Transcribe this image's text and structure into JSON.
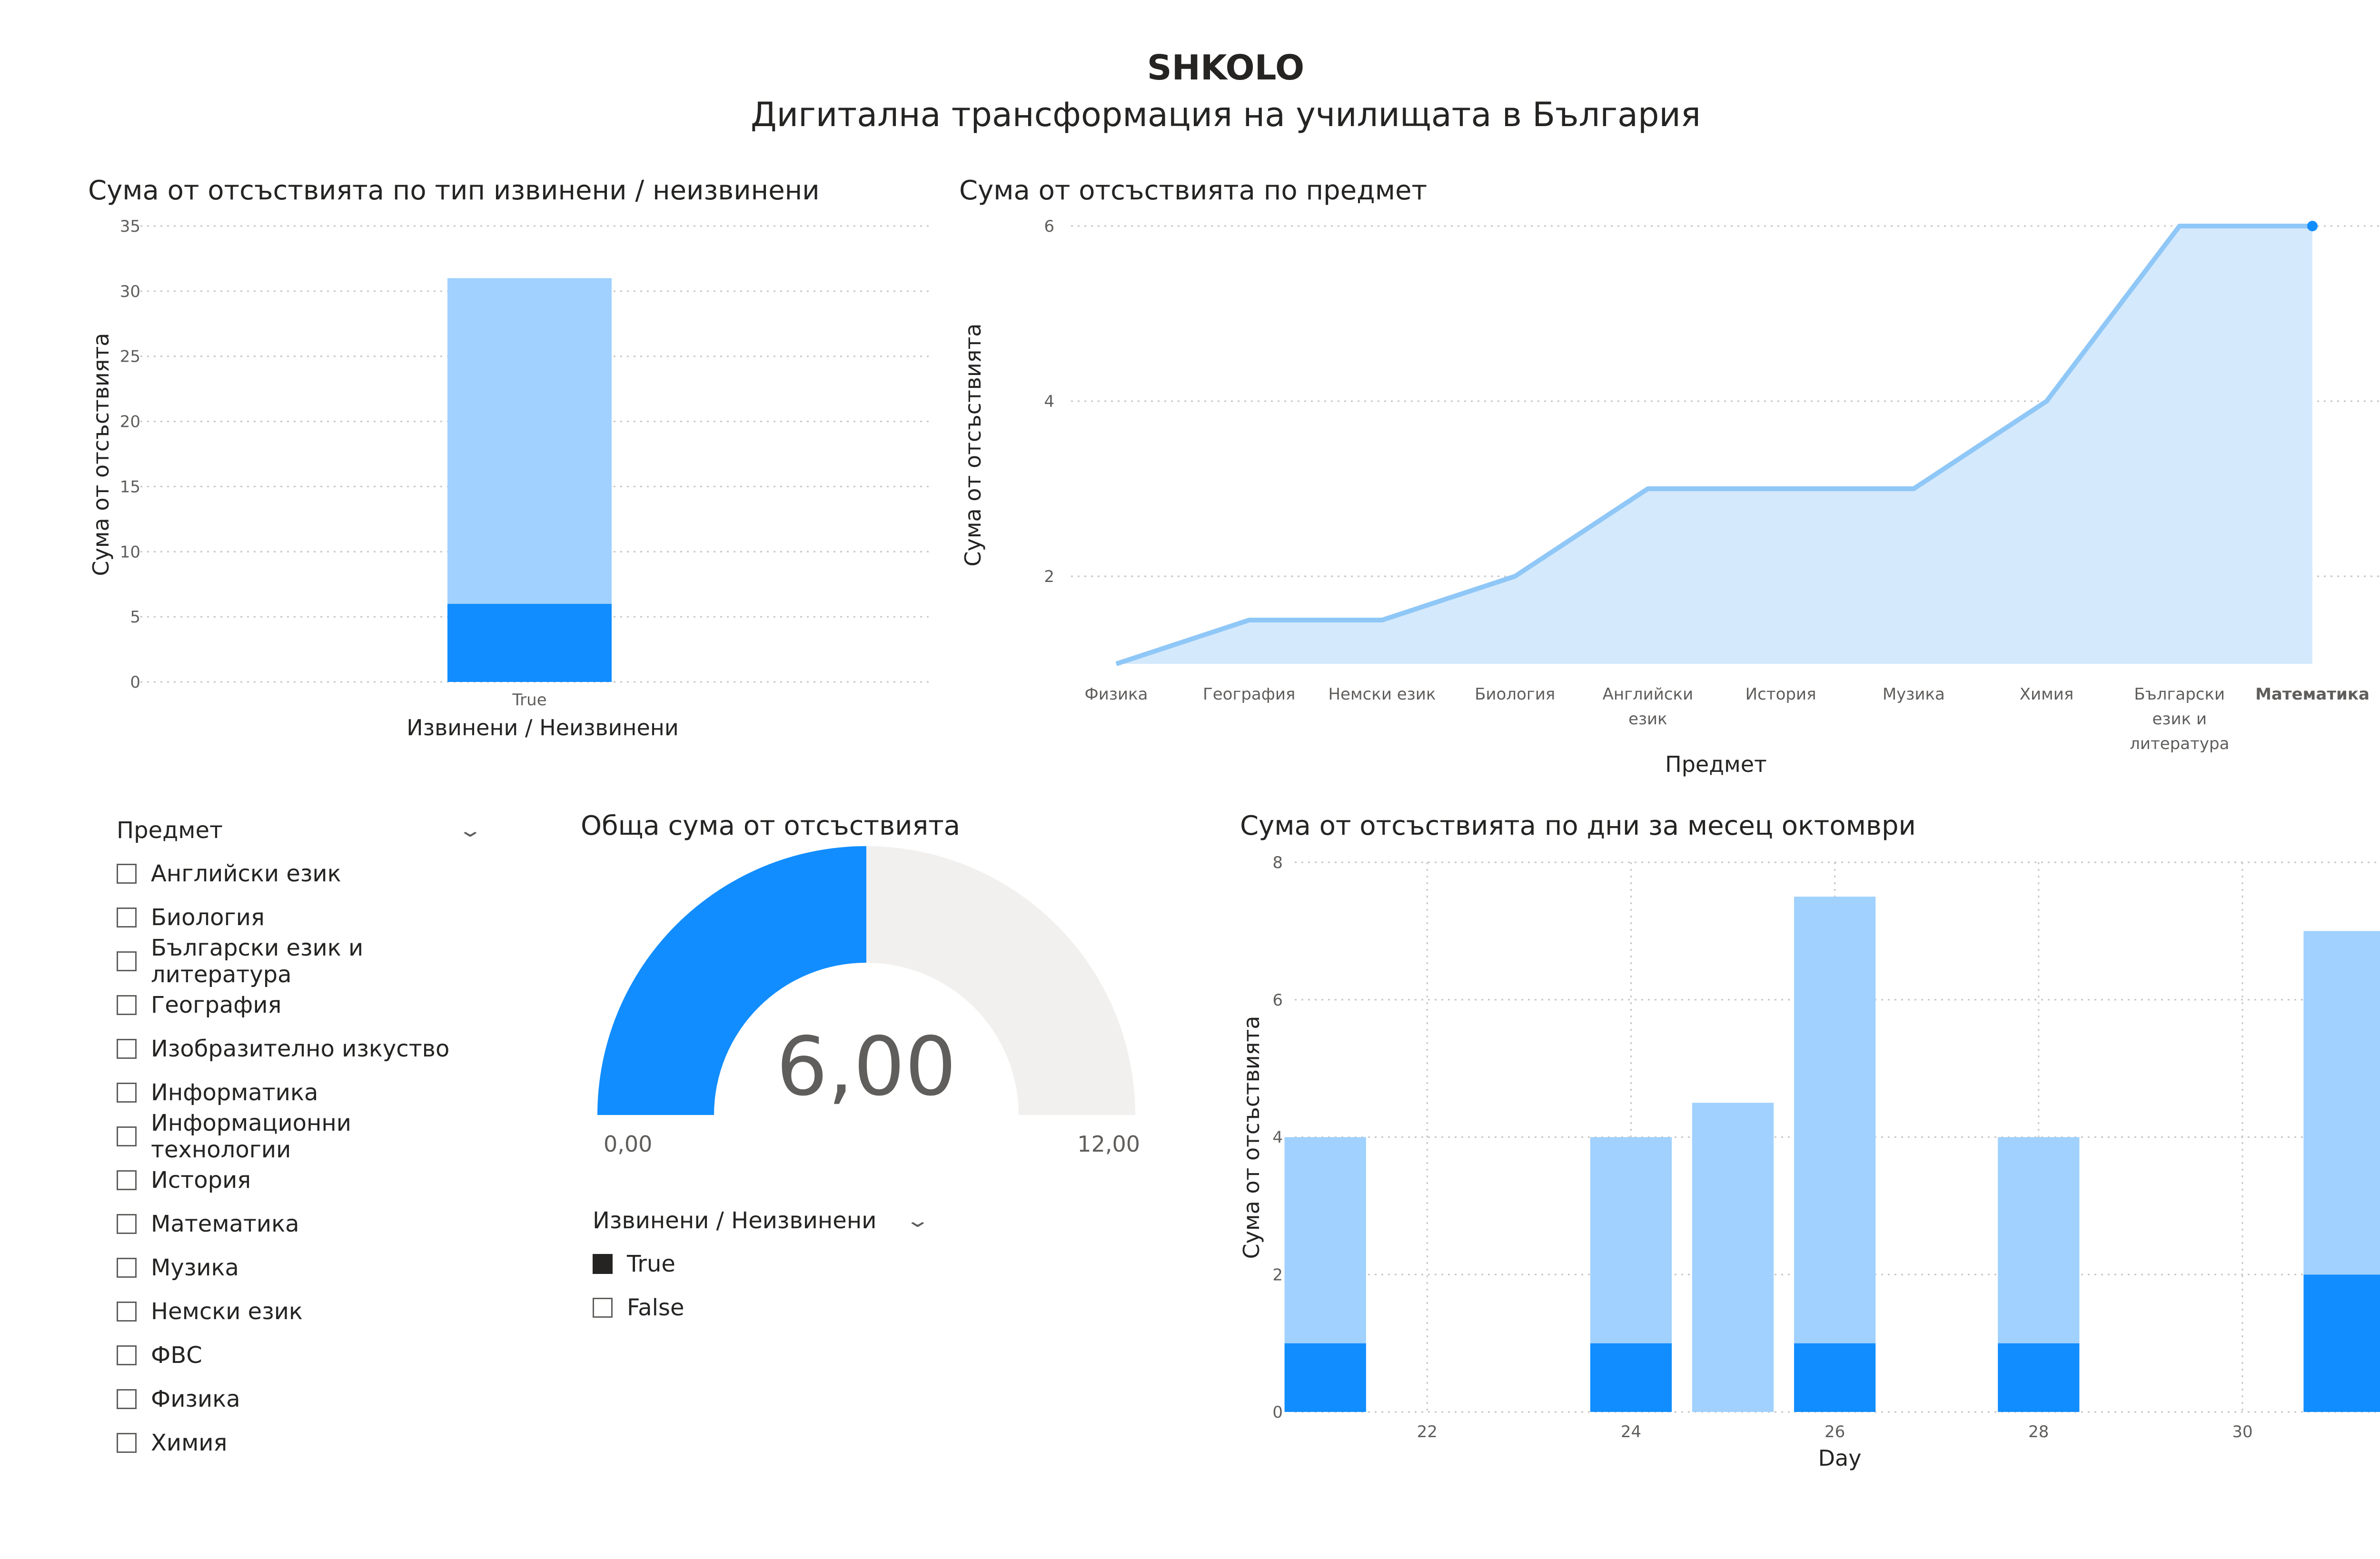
{
  "header": {
    "title": "SHKOLO",
    "subtitle": "Дигитална трансформация на училищата в България"
  },
  "colors": {
    "dark_blue": "#118dff",
    "light_blue": "#a0d1ff",
    "area_fill": "#d4e9fc",
    "line_blue": "#8fc7f7",
    "gauge_empty": "#f1f0ef"
  },
  "chart_data": [
    {
      "id": "excused-stacked",
      "type": "bar",
      "title": "Сума от отсъствията по тип извинени / неизвинени",
      "xlabel": "Извинени / Неизвинени",
      "ylabel": "Сума от отсъствията",
      "categories": [
        "True"
      ],
      "series": [
        {
          "values": [
            6
          ],
          "color": "#118dff"
        },
        {
          "values": [
            25
          ],
          "color": "#a0d1ff"
        }
      ],
      "ylim": [
        0,
        35
      ],
      "yticks": [
        "0",
        "5",
        "10",
        "15",
        "20",
        "25",
        "30",
        "35"
      ],
      "stacked": true,
      "grid": true
    },
    {
      "id": "absences-by-subject",
      "type": "area",
      "title": "Сума от отсъствията по предмет",
      "xlabel": "Предмет",
      "ylabel": "Сума от отсъствията",
      "categories": [
        [
          "Физика"
        ],
        [
          "География"
        ],
        [
          "Немски език"
        ],
        [
          "Биология"
        ],
        [
          "Английски",
          "език"
        ],
        [
          "История"
        ],
        [
          "Музика"
        ],
        [
          "Химия"
        ],
        [
          "Български",
          "език и",
          "литература"
        ],
        [
          "Математика"
        ]
      ],
      "values": [
        0,
        0.5,
        0.5,
        1,
        2,
        2,
        2,
        3,
        5,
        5
      ],
      "ylim": [
        0,
        5
      ],
      "yticks": [
        {
          "value": 1,
          "label": "2"
        },
        {
          "value": 3,
          "label": "4"
        },
        {
          "value": 5,
          "label": "6"
        }
      ],
      "highlighted_category": "Математика",
      "grid": true
    },
    {
      "id": "absences-by-day",
      "type": "bar",
      "title": "Сума от отсъствията по дни за месец октомври",
      "xlabel": "Day",
      "ylabel": "Сума от отсъствията",
      "x": [
        21,
        24,
        25,
        26,
        28,
        31
      ],
      "series": [
        {
          "values": [
            1,
            1,
            0,
            1,
            1,
            2
          ],
          "color": "#118dff"
        },
        {
          "values": [
            3,
            3,
            4.5,
            6.5,
            3,
            5
          ],
          "color": "#a0d1ff"
        }
      ],
      "xlim": [
        20.7,
        31.35
      ],
      "xticks": [
        "22",
        "24",
        "26",
        "28",
        "30"
      ],
      "ylim": [
        0,
        8
      ],
      "yticks": [
        "0",
        "2",
        "4",
        "6",
        "8"
      ],
      "stacked": true,
      "grid": true
    }
  ],
  "gauge": {
    "title": "Обща сума от отсъствията",
    "value": 6,
    "min": 0,
    "max": 12,
    "value_label": "6,00",
    "min_label": "0,00",
    "max_label": "12,00"
  },
  "slicer_subject": {
    "header": "Предмет",
    "items": [
      {
        "label": "Английски език",
        "checked": false
      },
      {
        "label": "Биология",
        "checked": false
      },
      {
        "label": "Български език и литература",
        "checked": false
      },
      {
        "label": "География",
        "checked": false
      },
      {
        "label": "Изобразително изкуство",
        "checked": false
      },
      {
        "label": "Информатика",
        "checked": false
      },
      {
        "label": "Информационни технологии",
        "checked": false
      },
      {
        "label": "История",
        "checked": false
      },
      {
        "label": "Математика",
        "checked": false
      },
      {
        "label": "Музика",
        "checked": false
      },
      {
        "label": "Немски език",
        "checked": false
      },
      {
        "label": "ФВС",
        "checked": false
      },
      {
        "label": "Физика",
        "checked": false
      },
      {
        "label": "Химия",
        "checked": false
      }
    ]
  },
  "slicer_excused": {
    "header": "Извинени / Неизвинени",
    "items": [
      {
        "label": "True",
        "checked": true
      },
      {
        "label": "False",
        "checked": false
      }
    ]
  }
}
